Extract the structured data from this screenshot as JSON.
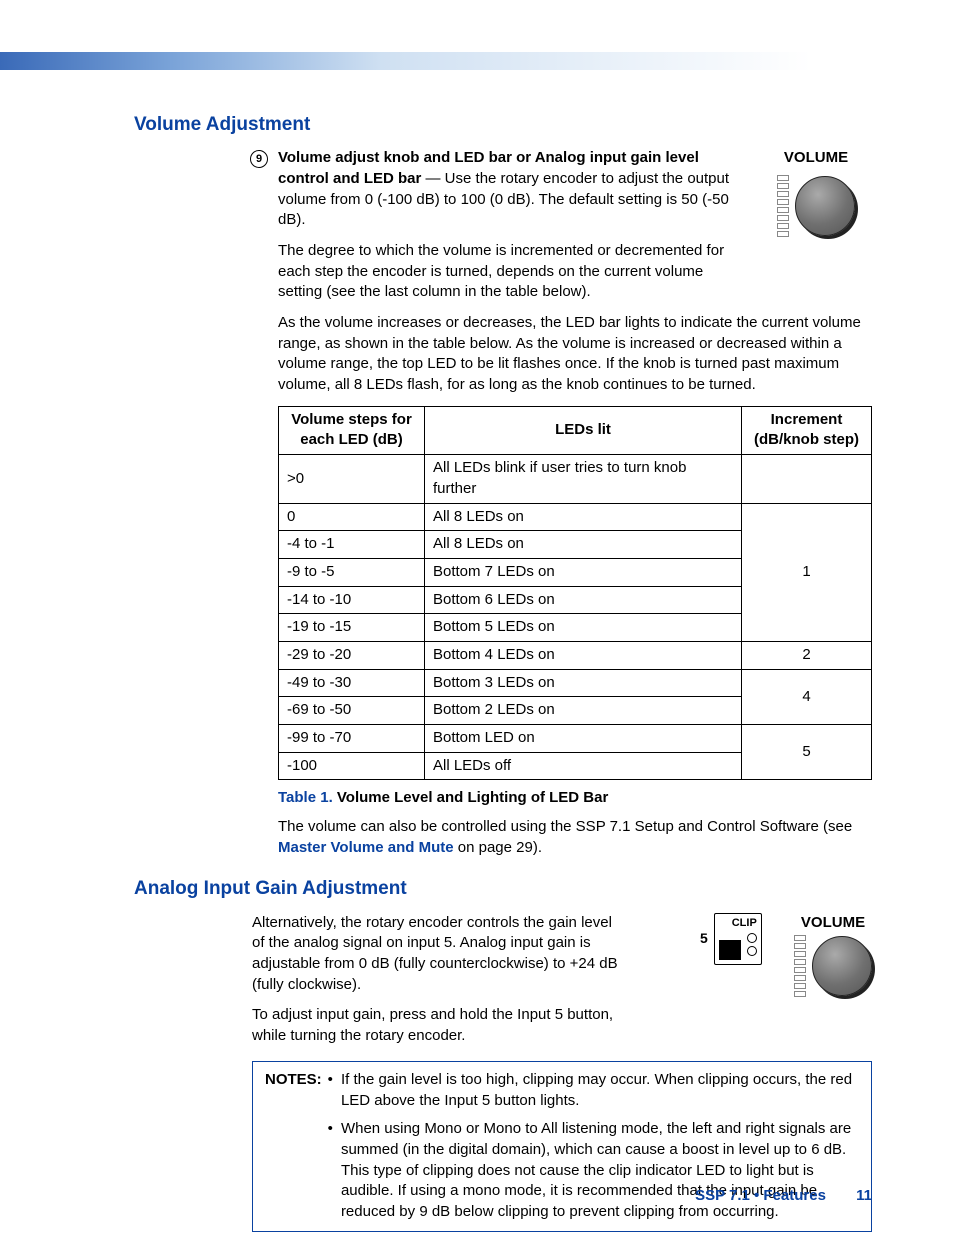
{
  "section1": {
    "heading": "Volume Adjustment",
    "callout_num": "9",
    "bold_lead": "Volume adjust knob and LED bar or Analog input gain level control and LED bar",
    "p1_tail": " — Use the rotary encoder to adjust the output volume from 0 (-100 dB) to 100 (0 dB). The default setting is 50 (-50 dB).",
    "p2": "The degree to which the volume is incremented or decremented for each step the encoder is turned, depends on the current volume setting (see the last column in the table below).",
    "p3": "As the volume increases or decreases, the LED bar lights to indicate the current volume range, as shown in the table below. As the volume is increased or decreased within a volume range, the top LED to be lit flashes once. If the knob is turned past maximum volume, all 8 LEDs flash, for as long as the knob continues to be turned.",
    "vol_label": "VOLUME"
  },
  "table": {
    "h1": "Volume steps for each LED (dB)",
    "h2": "LEDs lit",
    "h3": "Increment (dB/knob step)",
    "rows": [
      {
        "steps": ">0",
        "leds": "All LEDs blink if user tries to turn knob further"
      },
      {
        "steps": "0",
        "leds": "All 8 LEDs on"
      },
      {
        "steps": "-4 to -1",
        "leds": "All 8 LEDs on"
      },
      {
        "steps": "-9 to -5",
        "leds": "Bottom 7 LEDs on"
      },
      {
        "steps": "-14 to -10",
        "leds": "Bottom 6 LEDs on"
      },
      {
        "steps": "-19 to -15",
        "leds": "Bottom 5 LEDs on"
      },
      {
        "steps": "-29 to -20",
        "leds": "Bottom 4 LEDs on"
      },
      {
        "steps": "-49 to -30",
        "leds": "Bottom 3 LEDs on"
      },
      {
        "steps": "-69 to -50",
        "leds": "Bottom 2 LEDs on"
      },
      {
        "steps": "-99 to -70",
        "leds": "Bottom LED on"
      },
      {
        "steps": "-100",
        "leds": "All LEDs off"
      }
    ],
    "inc": {
      "blank": "",
      "g1": "1",
      "g2": "2",
      "g3": "4",
      "g4": "5"
    },
    "caption_lead": "Table 1.",
    "caption_title": "  Volume Level and Lighting of LED Bar",
    "after_text_a": "The volume can also be controlled using the SSP 7.1 Setup and Control Software (see ",
    "after_link": "Master Volume and Mute",
    "after_text_b": " on page 29)."
  },
  "section2": {
    "heading": "Analog Input Gain Adjustment",
    "p1": "Alternatively, the rotary encoder controls the gain level of the analog signal on input 5. Analog input gain is adjustable from 0 dB (fully counterclockwise) to +24 dB (fully clockwise).",
    "p2": "To adjust input gain, press and hold the Input 5 button, while turning the rotary encoder.",
    "clip_label": "CLIP",
    "btn5_label": "5",
    "vol_label": "VOLUME"
  },
  "notes": {
    "label": "NOTES:",
    "items": [
      "If the gain level is too high, clipping may occur. When clipping occurs, the red LED above the Input 5 button lights.",
      "When using Mono or Mono to All listening mode, the left and right signals are summed (in the digital domain), which can cause a boost in level up to 6 dB. This type of clipping does not cause the clip indicator LED to light but is audible. If using a mono mode, it is recommended that the input gain be reduced by 9 dB below clipping to prevent clipping from occurring."
    ]
  },
  "footer": {
    "text": "SSP 7.1 • Features",
    "page": "11"
  }
}
